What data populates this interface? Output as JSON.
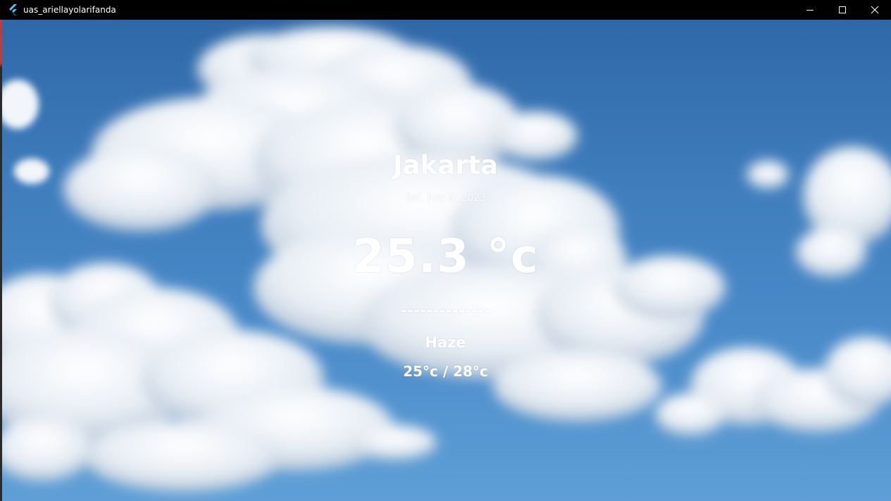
{
  "window": {
    "title": "uas_ariellayolarifanda",
    "app_icon": "flutter-icon",
    "controls": [
      "minimize-icon",
      "maximize-icon",
      "close-icon"
    ]
  },
  "weather": {
    "city": "Jakarta",
    "date": "Sat, July 8, 2023",
    "temperature": "25.3 °c",
    "divider": "--------------",
    "condition": "Haze",
    "range": "25°c / 28°c"
  },
  "colors": {
    "titlebar": "#000000",
    "sky": "#3f7dbd",
    "text": "#ffffff"
  }
}
